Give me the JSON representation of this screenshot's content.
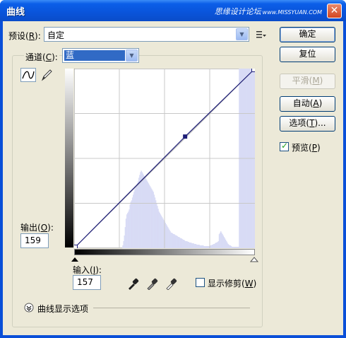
{
  "window": {
    "title": "曲线",
    "watermark_cn": "思缘设计论坛",
    "watermark_en": "www.MISSYUAN.COM"
  },
  "preset": {
    "label_pre": "预设(",
    "label_key": "R",
    "label_post": "):",
    "value": "自定"
  },
  "channel": {
    "label_pre": "通道(",
    "label_key": "C",
    "label_post": "):",
    "value": "蓝"
  },
  "output": {
    "label_pre": "输出(",
    "label_key": "O",
    "label_post": "):",
    "value": "159"
  },
  "input": {
    "label_pre": "输入(",
    "label_key": "I",
    "label_post": "):",
    "value": "157"
  },
  "clipping": {
    "label_pre": "显示修剪(",
    "label_key": "W",
    "label_post": ")",
    "checked": false
  },
  "display_options": {
    "label": "曲线显示选项"
  },
  "buttons": {
    "ok": "确定",
    "reset": "复位",
    "smooth_pre": "平滑(",
    "smooth_key": "M",
    "smooth_post": ")",
    "auto_pre": "自动(",
    "auto_key": "A",
    "auto_post": ")",
    "options_pre": "选项(",
    "options_key": "T",
    "options_post": ")..."
  },
  "preview": {
    "label_pre": "预览(",
    "label_key": "P",
    "label_post": ")",
    "checked": true
  },
  "colors": {
    "histogram": "#d8dbf5",
    "curve": "#1e1e78",
    "titlebar": "#0a54da",
    "dialog": "#ece9d8"
  },
  "curve": {
    "points": [
      [
        0,
        0
      ],
      [
        157,
        159
      ],
      [
        255,
        255
      ]
    ],
    "histogram": [
      0,
      0,
      0,
      0,
      0,
      0,
      0,
      0,
      0,
      0,
      0,
      0,
      0,
      0,
      0,
      0,
      0,
      0,
      0,
      0,
      0,
      0,
      0,
      0,
      0,
      0,
      0,
      0,
      0,
      0,
      0,
      0,
      0,
      0,
      0,
      0,
      0,
      0,
      0,
      0,
      0,
      0,
      0,
      0,
      0,
      0,
      0,
      0,
      0,
      0,
      0,
      0,
      0,
      0,
      0,
      0,
      0,
      0,
      0,
      0,
      4,
      10,
      18,
      30,
      42,
      48,
      50,
      52,
      55,
      62,
      66,
      68,
      72,
      76,
      80,
      84,
      86,
      88,
      92,
      95,
      100,
      104,
      108,
      110,
      108,
      106,
      104,
      102,
      100,
      98,
      96,
      94,
      92,
      90,
      88,
      86,
      84,
      82,
      80,
      76,
      72,
      68,
      64,
      60,
      56,
      52,
      50,
      48,
      46,
      44,
      42,
      40,
      38,
      36,
      34,
      32,
      30,
      28,
      26,
      24,
      22,
      22,
      21,
      20,
      20,
      19,
      18,
      18,
      17,
      16,
      16,
      15,
      14,
      14,
      13,
      12,
      12,
      11,
      10,
      10,
      10,
      9,
      9,
      8,
      8,
      8,
      7,
      7,
      7,
      6,
      6,
      6,
      5,
      5,
      5,
      5,
      4,
      4,
      4,
      4,
      4,
      3,
      3,
      3,
      3,
      3,
      3,
      3,
      3,
      4,
      4,
      5,
      5,
      6,
      6,
      7,
      8,
      8,
      9,
      10,
      20,
      22,
      24,
      22,
      20,
      18,
      16,
      14,
      12,
      10,
      8,
      6,
      5,
      4,
      4,
      3,
      2,
      2,
      2,
      2,
      2,
      2,
      2,
      2,
      2,
      255,
      255,
      255,
      255,
      255,
      255,
      255,
      255,
      255,
      255,
      255,
      255,
      255,
      255,
      255,
      255,
      255,
      255,
      255,
      255
    ]
  }
}
